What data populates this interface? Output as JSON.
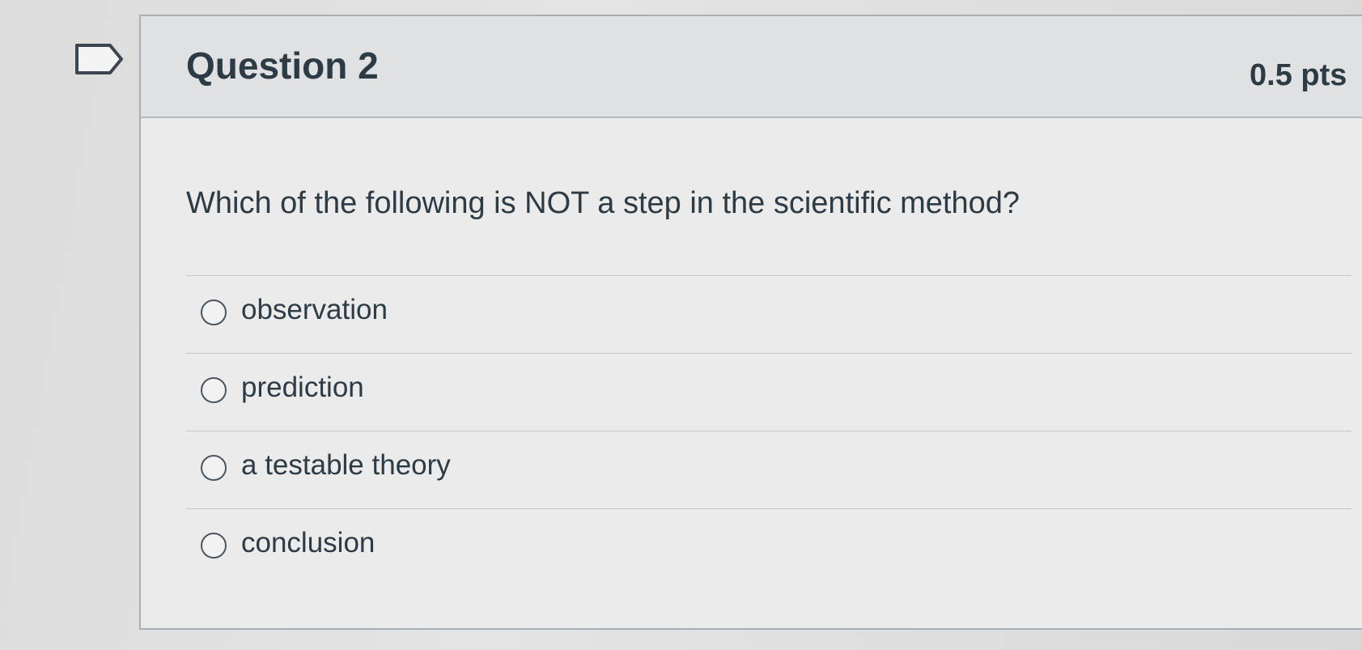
{
  "question": {
    "title": "Question 2",
    "points": "0.5 pts",
    "text": "Which of the following is NOT a step in the scientific method?",
    "answers": [
      {
        "label": "observation",
        "selected": false
      },
      {
        "label": "prediction",
        "selected": false
      },
      {
        "label": "a testable theory",
        "selected": false
      },
      {
        "label": "conclusion",
        "selected": false
      }
    ]
  },
  "icons": {
    "flag": "flag-question-icon"
  },
  "colors": {
    "text": "#2d3b45",
    "header_bg": "#e0e1e2",
    "border": "#a9aeb2"
  }
}
